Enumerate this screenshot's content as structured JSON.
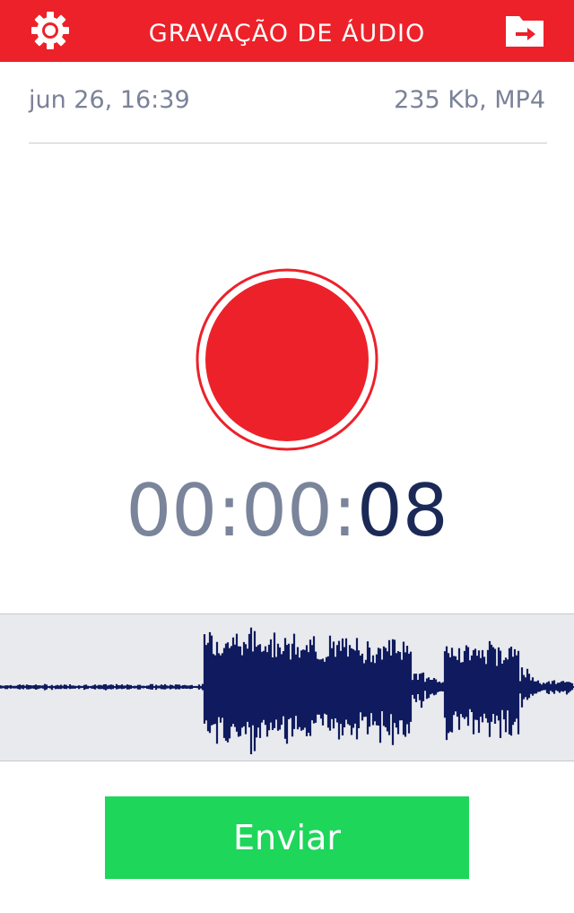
{
  "header": {
    "title": "GRAVAÇÃO DE ÁUDIO",
    "settings_icon": "gear-icon",
    "folder_icon": "folder-export-icon"
  },
  "info": {
    "date": "jun 26, 16:39",
    "meta": "235 Kb, MP4"
  },
  "recorder": {
    "timer_prefix": "00:00:",
    "timer_seconds": "08"
  },
  "actions": {
    "send_label": "Enviar"
  },
  "colors": {
    "accent": "#ed2129",
    "waveform": "#0f1b5e",
    "send": "#1ed65a"
  }
}
